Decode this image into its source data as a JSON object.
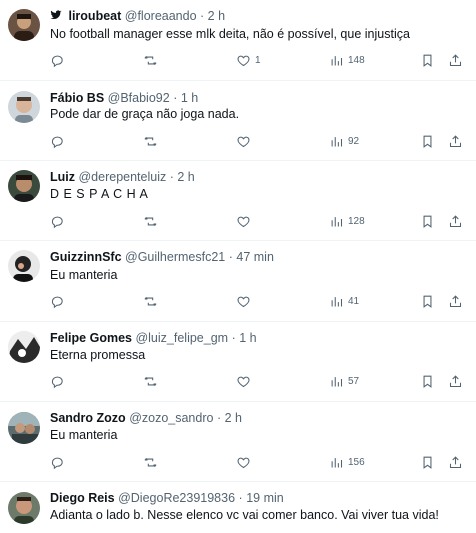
{
  "replies": [
    {
      "name": "liroubeat",
      "handle": "@floreaando",
      "time": "2 h",
      "text": "No football manager esse mlk deita, não é possível, que injustiça",
      "likes": "1",
      "views": "148",
      "bird": true
    },
    {
      "name": "Fábio BS",
      "handle": "@Bfabio92",
      "time": "1 h",
      "text": "Pode dar de graça não joga nada.",
      "likes": "",
      "views": "92"
    },
    {
      "name": "Luiz",
      "handle": "@derepenteluiz",
      "time": "2 h",
      "text": "D E S P A C H A",
      "likes": "",
      "views": "128"
    },
    {
      "name": "GuizzinnSfc",
      "handle": "@Guilhermesfc21",
      "time": "47 min",
      "text": "Eu manteria",
      "likes": "",
      "views": "41"
    },
    {
      "name": "Felipe Gomes",
      "handle": "@luiz_felipe_gm",
      "time": "1 h",
      "text": "Eterna promessa",
      "likes": "",
      "views": "57"
    },
    {
      "name": "Sandro Zozo",
      "handle": "@zozo_sandro",
      "time": "2 h",
      "text": "Eu manteria",
      "likes": "",
      "views": "156"
    },
    {
      "name": "Diego Reis",
      "handle": "@DiegoRe23919836",
      "time": "19 min",
      "text": "Adianta o lado b. Nesse elenco vc vai comer banco. Vai viver tua vida!",
      "likes": "",
      "views": ""
    }
  ],
  "separator": "·",
  "colors": {
    "text": "#0f1419",
    "muted": "#536471",
    "divider": "#eff3f4"
  }
}
